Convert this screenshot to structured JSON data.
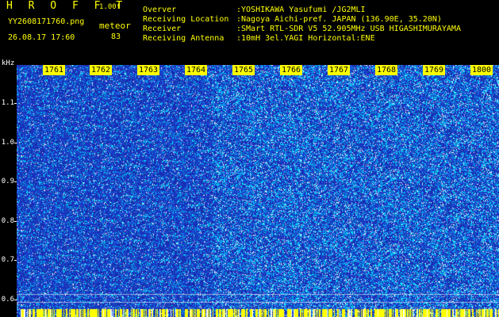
{
  "app": {
    "title": "H R O F F T",
    "version": "1.00f"
  },
  "file": {
    "name": "YY2608171760.png",
    "datetime": "26.08.17 17:60"
  },
  "meteor": {
    "label": "meteor",
    "count": "83"
  },
  "station": [
    {
      "key": "Overver",
      "value": ":YOSHIKAWA Yasufumi /JG2MLI"
    },
    {
      "key": "Receiving Location",
      "value": ":Nagoya Aichi-pref. JAPAN (136.90E, 35.20N)"
    },
    {
      "key": "Receiver",
      "value": ":SMart RTL-SDR V5 52.905MHz USB HIGASHIMURAYAMA"
    },
    {
      "key": "Receiving Antenna",
      "value": ":10mH 3el.YAGI Horizontal:ENE"
    }
  ],
  "plot": {
    "y_unit": "kHz",
    "y_ticks": [
      "1.1",
      "1.0",
      "0.9",
      "0.8",
      "0.7",
      "0.6"
    ],
    "minute_labels": [
      "1761",
      "1762",
      "1763",
      "1764",
      "1765",
      "1766",
      "1767",
      "1768",
      "1769",
      "1800"
    ]
  },
  "colors": {
    "background": "#000000",
    "text": "#ffff00",
    "plot_base": "#1d2fb0",
    "noise_bright": "#00d6ff",
    "noise_white": "#ffffff",
    "marker": "#ffff00"
  }
}
